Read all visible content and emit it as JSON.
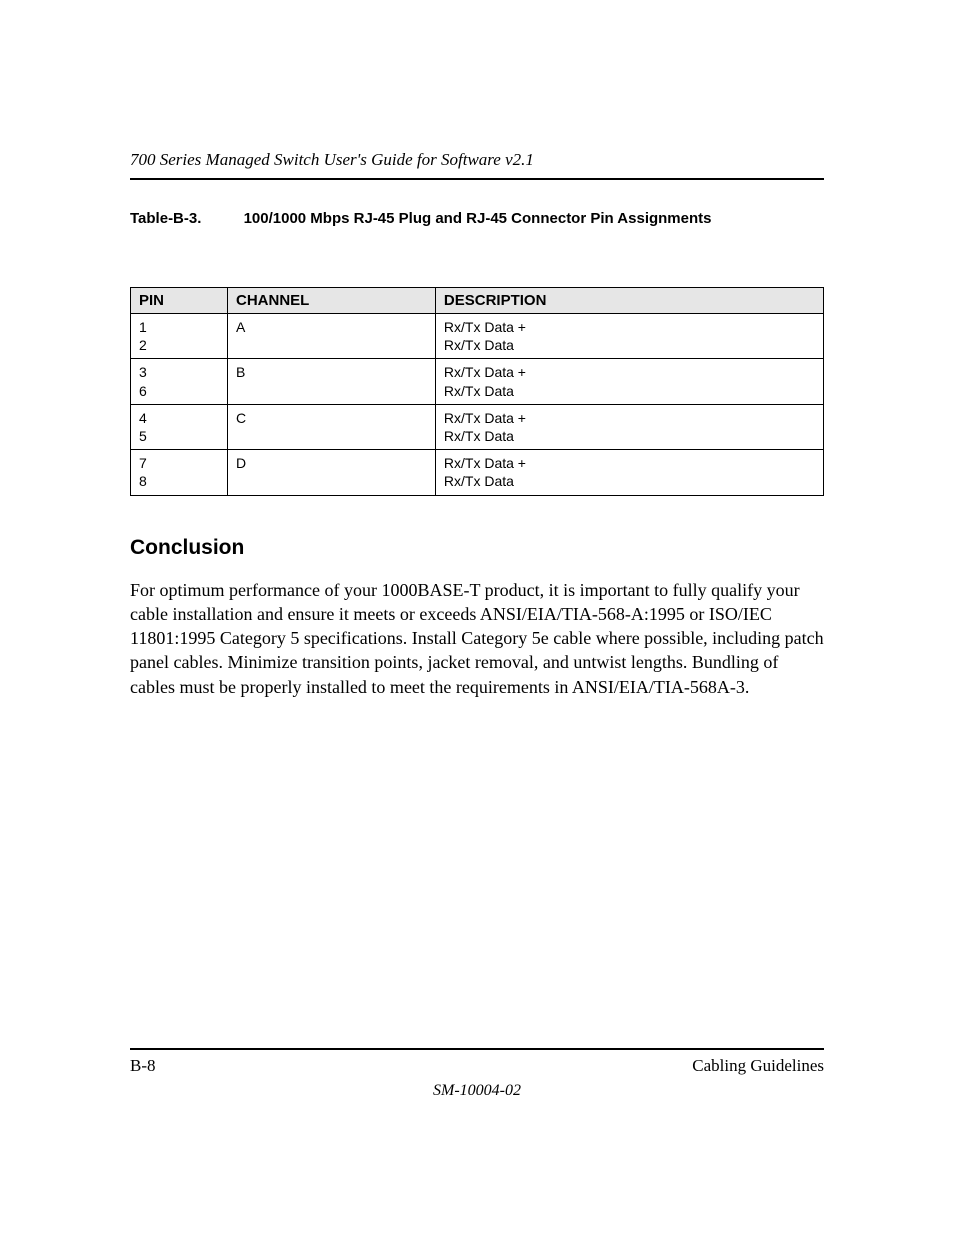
{
  "header": {
    "running_title": "700 Series Managed Switch User's Guide for Software v2.1"
  },
  "table": {
    "caption_number": "Table-B-3.",
    "caption_title": "100/1000 Mbps RJ-45 Plug and RJ-45 Connector Pin Assignments",
    "headers": {
      "pin": "PIN",
      "channel": "CHANNEL",
      "description": "DESCRIPTION"
    },
    "rows": [
      {
        "pin_a": "1",
        "pin_b": "2",
        "channel": "A",
        "desc_a": "Rx/Tx Data +",
        "desc_b": "Rx/Tx Data"
      },
      {
        "pin_a": "3",
        "pin_b": "6",
        "channel": "B",
        "desc_a": "Rx/Tx Data +",
        "desc_b": "Rx/Tx Data"
      },
      {
        "pin_a": "4",
        "pin_b": "5",
        "channel": "C",
        "desc_a": "Rx/Tx Data +",
        "desc_b": "Rx/Tx Data"
      },
      {
        "pin_a": "7",
        "pin_b": "8",
        "channel": "D",
        "desc_a": "Rx/Tx Data +",
        "desc_b": "Rx/Tx Data"
      }
    ]
  },
  "section": {
    "heading": "Conclusion",
    "paragraph": "For optimum performance of your 1000BASE-T product, it is important to fully qualify your cable installation and ensure it meets or exceeds ANSI/EIA/TIA-568-A:1995 or ISO/IEC 11801:1995 Category 5 specifications. Install Category 5e cable where possible, including patch panel cables. Minimize transition points, jacket removal, and untwist lengths. Bundling of cables must be properly installed to meet the requirements in ANSI/EIA/TIA-568A-3."
  },
  "footer": {
    "page_number": "B-8",
    "section_title": "Cabling Guidelines",
    "doc_id": "SM-10004-02"
  }
}
